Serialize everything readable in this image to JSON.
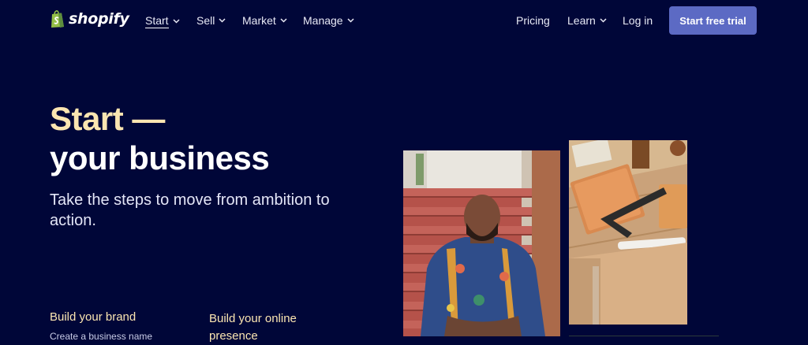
{
  "brand": {
    "name": "shopify"
  },
  "nav": {
    "left": [
      {
        "label": "Start",
        "active": true
      },
      {
        "label": "Sell"
      },
      {
        "label": "Market"
      },
      {
        "label": "Manage"
      }
    ],
    "pricing": "Pricing",
    "learn": "Learn",
    "login": "Log in",
    "cta": "Start free trial"
  },
  "hero": {
    "title_line1": "Start —",
    "title_line2": "your business",
    "subtitle": "Take the steps to move from ambition to action."
  },
  "features": [
    {
      "title": "Build your brand",
      "desc": "Create a business name"
    },
    {
      "title": "Build your online presence"
    }
  ],
  "colors": {
    "background": "#000638",
    "accent": "#5c6ac4",
    "highlight": "#fbe5b1",
    "logo_green": "#95bf47"
  },
  "icons": [
    "shopify-bag-icon",
    "chevron-down-icon"
  ]
}
